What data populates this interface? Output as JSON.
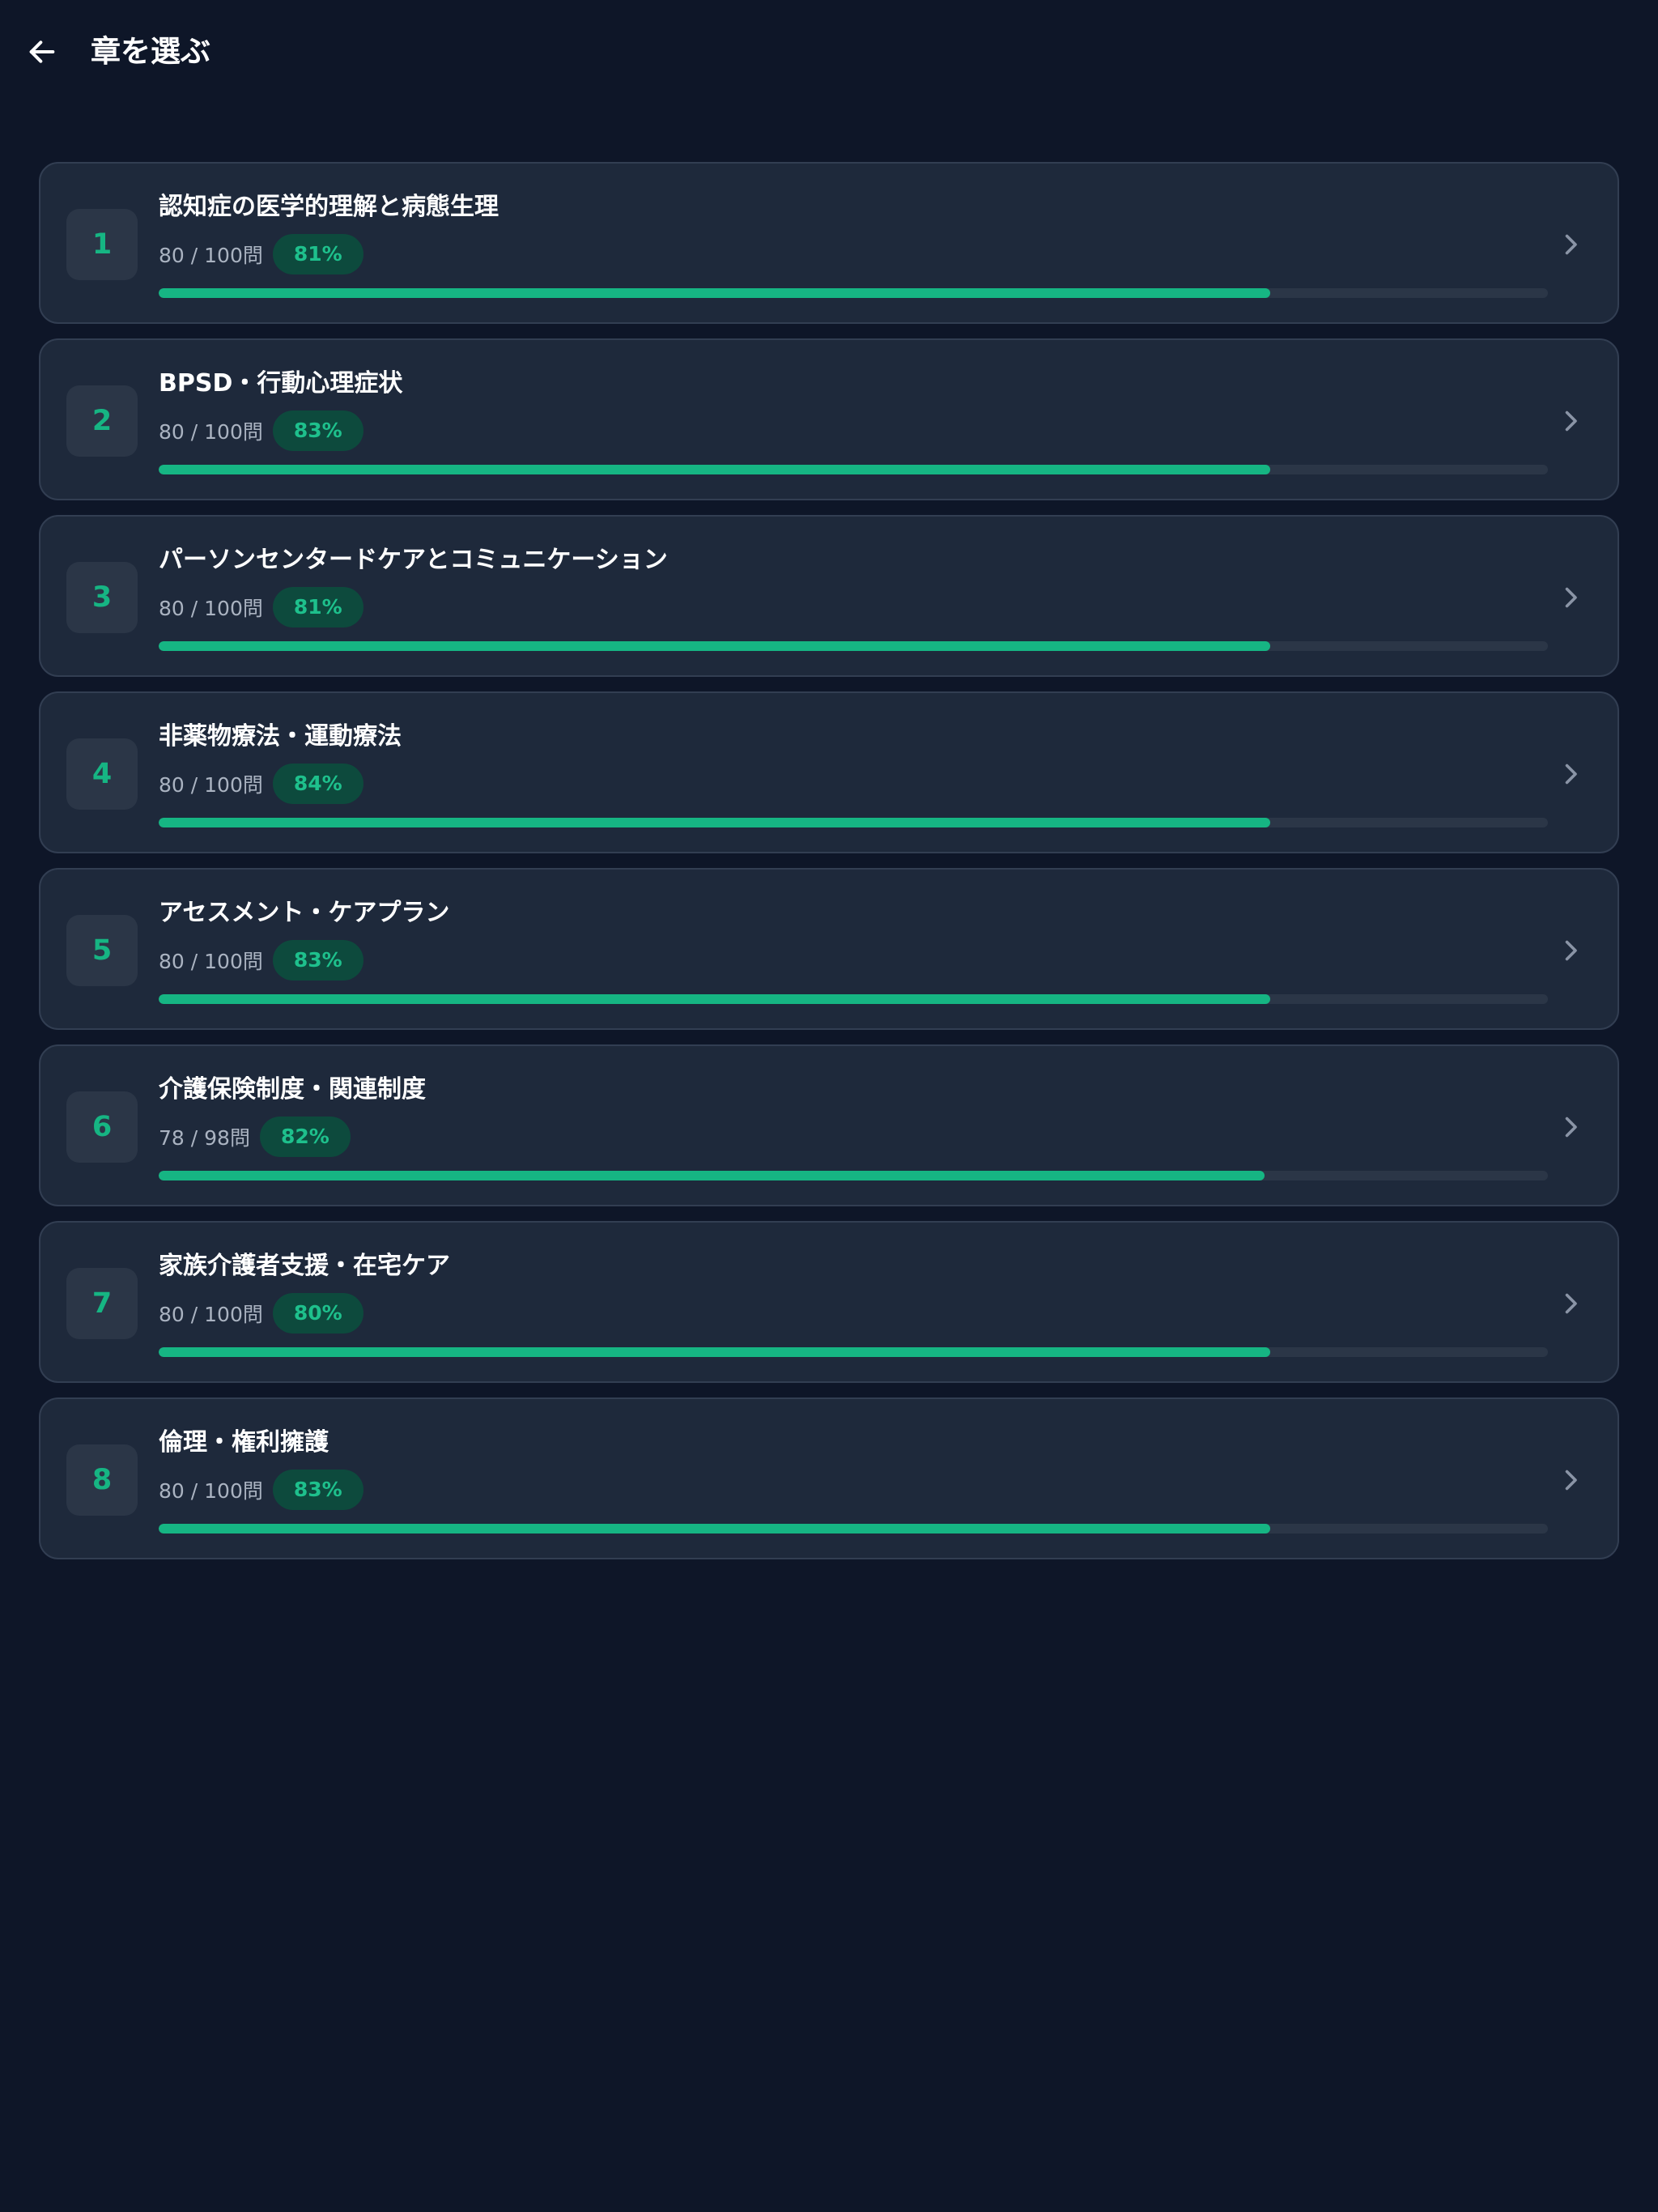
{
  "header": {
    "title": "章を選ぶ",
    "back_icon": "arrow-left-icon"
  },
  "colors": {
    "background": "#0e1628",
    "card": "#1e293b",
    "accent": "#16b583",
    "badge_bg": "#0d4a3d",
    "muted_text": "#aab3c1"
  },
  "chapters": [
    {
      "number": "1",
      "title": "認知症の医学的理解と病態生理",
      "count": "80 / 100問",
      "percent": "81%",
      "progress": 0.8
    },
    {
      "number": "2",
      "title": "BPSD・行動心理症状",
      "count": "80 / 100問",
      "percent": "83%",
      "progress": 0.8
    },
    {
      "number": "3",
      "title": "パーソンセンタードケアとコミュニケーション",
      "count": "80 / 100問",
      "percent": "81%",
      "progress": 0.8
    },
    {
      "number": "4",
      "title": "非薬物療法・運動療法",
      "count": "80 / 100問",
      "percent": "84%",
      "progress": 0.8
    },
    {
      "number": "5",
      "title": "アセスメント・ケアプラン",
      "count": "80 / 100問",
      "percent": "83%",
      "progress": 0.8
    },
    {
      "number": "6",
      "title": "介護保険制度・関連制度",
      "count": "78 / 98問",
      "percent": "82%",
      "progress": 0.796
    },
    {
      "number": "7",
      "title": "家族介護者支援・在宅ケア",
      "count": "80 / 100問",
      "percent": "80%",
      "progress": 0.8
    },
    {
      "number": "8",
      "title": "倫理・権利擁護",
      "count": "80 / 100問",
      "percent": "83%",
      "progress": 0.8
    }
  ]
}
